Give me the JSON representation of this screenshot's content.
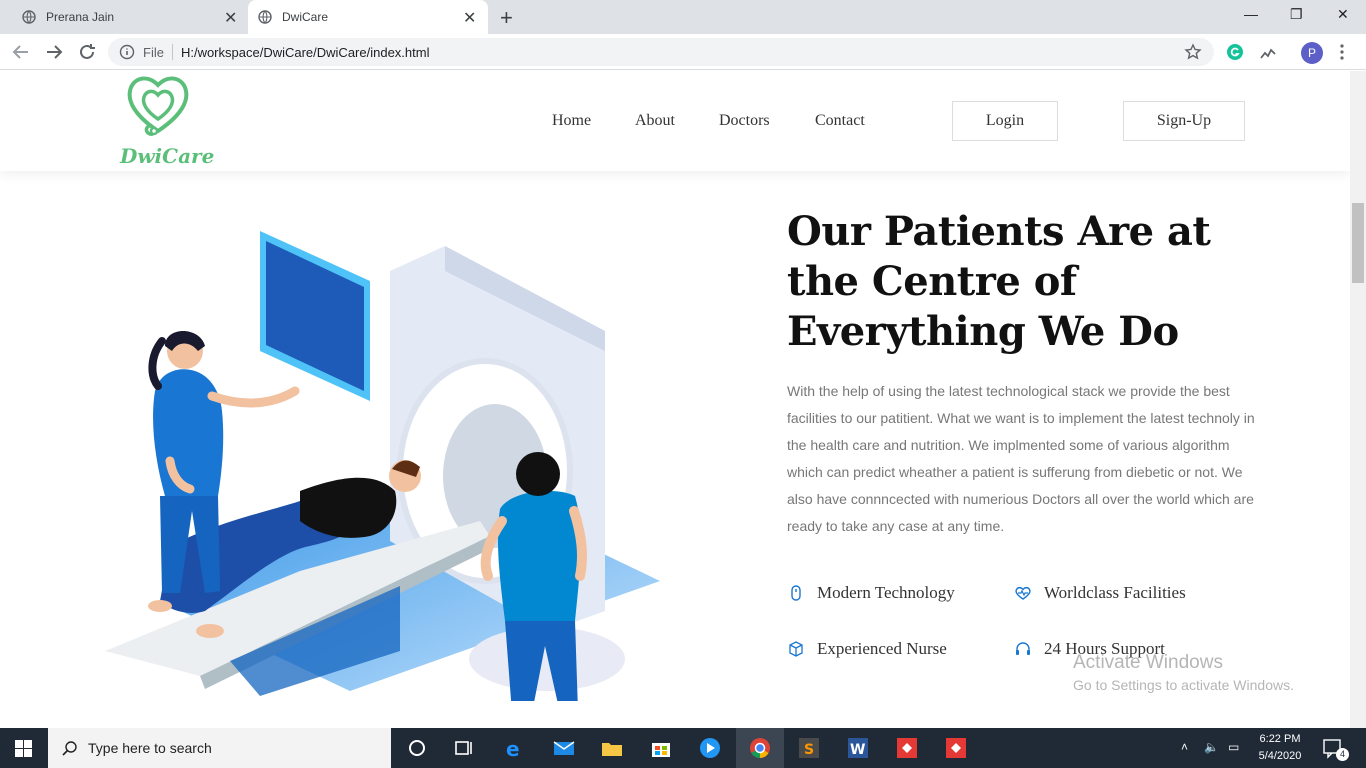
{
  "browser": {
    "tabs": [
      {
        "label": "Prerana Jain"
      },
      {
        "label": "DwiCare"
      }
    ],
    "address": {
      "scheme": "File",
      "url": "H:/workspace/DwiCare/DwiCare/index.html"
    },
    "profile_initial": "P"
  },
  "site": {
    "brand": "DwiCare",
    "nav": [
      "Home",
      "About",
      "Doctors",
      "Contact"
    ],
    "login_label": "Login",
    "signup_label": "Sign-Up",
    "colors": {
      "brand_green": "#5bbf7a",
      "accent_blue": "#1976d2"
    }
  },
  "hero": {
    "headline": "Our Patients Are at the Centre of Everything We Do",
    "body": "With the help of using the latest technological stack we provide the best facilities to our patitient. What we want is to implement the latest technoly in the health care and nutrition. We implmented some of various algorithm which can predict wheather a patient is sufferung from diebetic or not. We also have connncected with numerious Doctors all over the world which are ready to take any case at any time.",
    "features": [
      {
        "label": "Modern Technology",
        "icon": "mouse-icon"
      },
      {
        "label": "Worldclass Facilities",
        "icon": "heartbeat-icon"
      },
      {
        "label": "Experienced Nurse",
        "icon": "cube-icon"
      },
      {
        "label": "24 Hours Support",
        "icon": "headset-icon"
      }
    ]
  },
  "watermark": {
    "title": "Activate Windows",
    "subtitle": "Go to Settings to activate Windows."
  },
  "taskbar": {
    "search_placeholder": "Type here to search",
    "time": "6:22 PM",
    "date": "5/4/2020",
    "notifications": "4"
  }
}
